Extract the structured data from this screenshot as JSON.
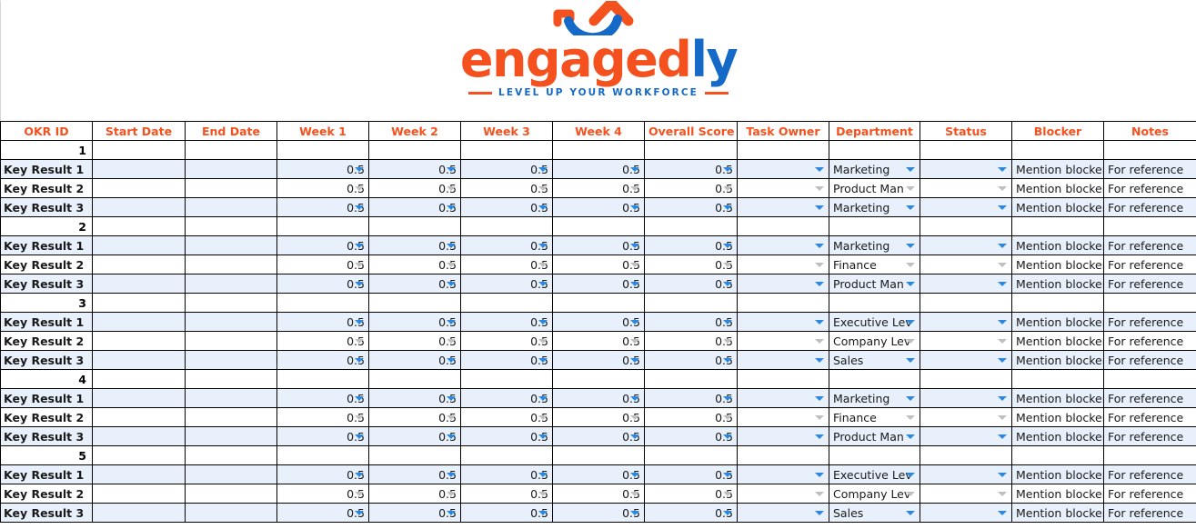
{
  "brand": {
    "logo_word_primary": "engaged",
    "logo_word_secondary": "ly",
    "tagline": "LEVEL UP YOUR WORKFORCE",
    "colors": {
      "orange": "#F4511E",
      "blue": "#1569C7",
      "header_text": "#F4511E",
      "row_stripe": "#E8F1FB",
      "caret_active": "#2E87DE",
      "caret_inactive": "#BFBFBF"
    },
    "logo_mark": "arrow-up-smile-icon"
  },
  "table": {
    "columns": [
      "OKR ID",
      "Start Date",
      "End Date",
      "Week 1",
      "Week 2",
      "Week 3",
      "Week 4",
      "Overall Score",
      "Task Owner",
      "Department",
      "Status",
      "Blocker",
      "Notes"
    ],
    "defaults": {
      "score": "0.5",
      "blocker": "Mention blocker",
      "notes": "For reference",
      "start_date": "",
      "end_date": "",
      "task_owner": "",
      "status": ""
    },
    "groups": [
      {
        "okr_id": "1",
        "rows": [
          {
            "label": "Key Result 1",
            "week1": "0.5",
            "week2": "0.5",
            "week3": "0.5",
            "week4": "0.5",
            "overall": "0.5",
            "owner": "",
            "department": "Marketing",
            "status": "",
            "blocker": "Mention blocker",
            "notes": "For reference"
          },
          {
            "label": "Key Result 2",
            "week1": "0.5",
            "week2": "0.5",
            "week3": "0.5",
            "week4": "0.5",
            "overall": "0.5",
            "owner": "",
            "department": "Product Man",
            "status": "",
            "blocker": "Mention blocker",
            "notes": "For reference"
          },
          {
            "label": "Key Result 3",
            "week1": "0.5",
            "week2": "0.5",
            "week3": "0.5",
            "week4": "0.5",
            "overall": "0.5",
            "owner": "",
            "department": "Marketing",
            "status": "",
            "blocker": "Mention blocker",
            "notes": "For reference"
          }
        ]
      },
      {
        "okr_id": "2",
        "rows": [
          {
            "label": "Key Result 1",
            "week1": "0.5",
            "week2": "0.5",
            "week3": "0.5",
            "week4": "0.5",
            "overall": "0.5",
            "owner": "",
            "department": "Marketing",
            "status": "",
            "blocker": "Mention blocker",
            "notes": "For reference"
          },
          {
            "label": "Key Result 2",
            "week1": "0.5",
            "week2": "0.5",
            "week3": "0.5",
            "week4": "0.5",
            "overall": "0.5",
            "owner": "",
            "department": "Finance",
            "status": "",
            "blocker": "Mention blocker",
            "notes": "For reference"
          },
          {
            "label": "Key Result 3",
            "week1": "0.5",
            "week2": "0.5",
            "week3": "0.5",
            "week4": "0.5",
            "overall": "0.5",
            "owner": "",
            "department": "Product Man",
            "status": "",
            "blocker": "Mention blocker",
            "notes": "For reference"
          }
        ]
      },
      {
        "okr_id": "3",
        "rows": [
          {
            "label": "Key Result 1",
            "week1": "0.5",
            "week2": "0.5",
            "week3": "0.5",
            "week4": "0.5",
            "overall": "0.5",
            "owner": "",
            "department": "Executive Lev",
            "status": "",
            "blocker": "Mention blocker",
            "notes": "For reference"
          },
          {
            "label": "Key Result 2",
            "week1": "0.5",
            "week2": "0.5",
            "week3": "0.5",
            "week4": "0.5",
            "overall": "0.5",
            "owner": "",
            "department": "Company Lev",
            "status": "",
            "blocker": "Mention blocker",
            "notes": "For reference"
          },
          {
            "label": "Key Result 3",
            "week1": "0.5",
            "week2": "0.5",
            "week3": "0.5",
            "week4": "0.5",
            "overall": "0.5",
            "owner": "",
            "department": "Sales",
            "status": "",
            "blocker": "Mention blocker",
            "notes": "For reference"
          }
        ]
      },
      {
        "okr_id": "4",
        "rows": [
          {
            "label": "Key Result 1",
            "week1": "0.5",
            "week2": "0.5",
            "week3": "0.5",
            "week4": "0.5",
            "overall": "0.5",
            "owner": "",
            "department": "Marketing",
            "status": "",
            "blocker": "Mention blocker",
            "notes": "For reference"
          },
          {
            "label": "Key Result 2",
            "week1": "0.5",
            "week2": "0.5",
            "week3": "0.5",
            "week4": "0.5",
            "overall": "0.5",
            "owner": "",
            "department": "Finance",
            "status": "",
            "blocker": "Mention blocker",
            "notes": "For reference"
          },
          {
            "label": "Key Result 3",
            "week1": "0.5",
            "week2": "0.5",
            "week3": "0.5",
            "week4": "0.5",
            "overall": "0.5",
            "owner": "",
            "department": "Product Man",
            "status": "",
            "blocker": "Mention blocker",
            "notes": "For reference"
          }
        ]
      },
      {
        "okr_id": "5",
        "rows": [
          {
            "label": "Key Result 1",
            "week1": "0.5",
            "week2": "0.5",
            "week3": "0.5",
            "week4": "0.5",
            "overall": "0.5",
            "owner": "",
            "department": "Executive Lev",
            "status": "",
            "blocker": "Mention blocker",
            "notes": "For reference"
          },
          {
            "label": "Key Result 2",
            "week1": "0.5",
            "week2": "0.5",
            "week3": "0.5",
            "week4": "0.5",
            "overall": "0.5",
            "owner": "",
            "department": "Company Lev",
            "status": "",
            "blocker": "Mention blocker",
            "notes": "For reference"
          },
          {
            "label": "Key Result 3",
            "week1": "0.5",
            "week2": "0.5",
            "week3": "0.5",
            "week4": "0.5",
            "overall": "0.5",
            "owner": "",
            "department": "Sales",
            "status": "",
            "blocker": "Mention blocker",
            "notes": "For reference"
          }
        ]
      }
    ]
  }
}
